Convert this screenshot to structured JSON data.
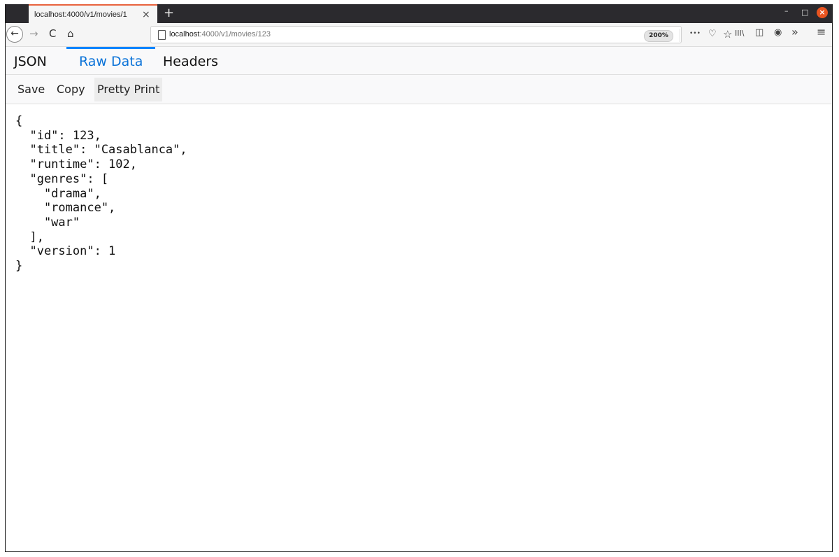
{
  "browser": {
    "tab_title": "localhost:4000/v1/movies/1",
    "new_tab_icon": "+",
    "url_host": "localhost",
    "url_rest": ":4000/v1/movies/123",
    "zoom_level": "200%",
    "icons": {
      "back": "←",
      "forward": "→",
      "reload": "C",
      "home": "⌂",
      "menu_dots": "•••",
      "pocket": "♡",
      "bookmark": "☆",
      "library": "III\\",
      "sidebar": "◫",
      "account": "◉",
      "overflow": "»",
      "hamburger": "≡",
      "minimize": "–",
      "maximize": "□",
      "close": "×",
      "tab_close": "×"
    }
  },
  "viewer": {
    "tabs": [
      {
        "label": "JSON",
        "active": false
      },
      {
        "label": "Raw Data",
        "active": true
      },
      {
        "label": "Headers",
        "active": false
      }
    ],
    "toolbar": {
      "save": "Save",
      "copy": "Copy",
      "pretty_print": "Pretty Print"
    },
    "raw_text": "{\n  \"id\": 123,\n  \"title\": \"Casablanca\",\n  \"runtime\": 102,\n  \"genres\": [\n    \"drama\",\n    \"romance\",\n    \"war\"\n  ],\n  \"version\": 1\n}"
  }
}
